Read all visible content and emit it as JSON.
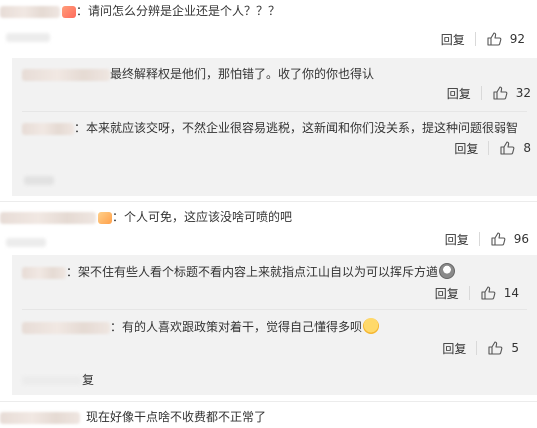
{
  "comments": [
    {
      "text": "：请问怎么分辨是企业还是个人？？？",
      "reply": "回复",
      "likes": "92",
      "replies": [
        {
          "text": "最终解释权是他们，那怕错了。收了你的你也得认",
          "reply": "回复",
          "likes": "32"
        },
        {
          "text": "：本来就应该交呀，不然企业很容易逃税，这新闻和你们没关系，提这种问题很弱智",
          "reply": "回复",
          "likes": "8"
        }
      ]
    },
    {
      "text": "：个人可免，这应该没啥可喷的吧",
      "reply": "回复",
      "likes": "96",
      "replies": [
        {
          "text": "：架不住有些人看个标题不看内容上来就指点江山自以为可以挥斥方遒",
          "reply": "回复",
          "likes": "14"
        },
        {
          "text": "：有的人喜欢跟政策对着干，觉得自己懂得多呗",
          "reply": "回复",
          "likes": "5"
        }
      ],
      "trailing_fragment": "复"
    },
    {
      "text": "现在好像干点啥不收费都不正常了"
    }
  ]
}
